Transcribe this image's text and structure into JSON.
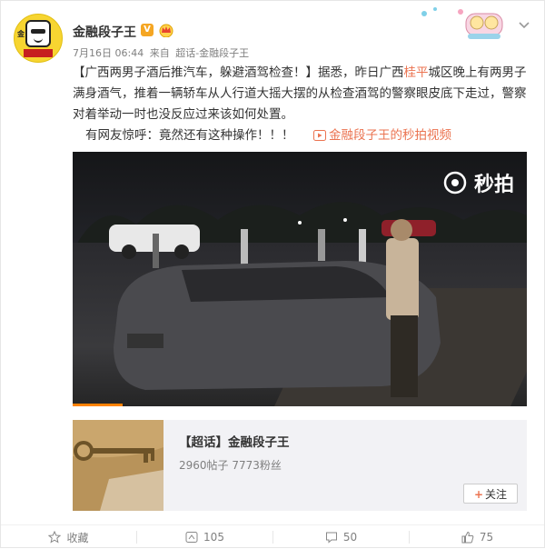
{
  "post": {
    "username": "金融段子王",
    "vip_badge": "V",
    "timestamp": "7月16日 06:44",
    "source_prefix": "来自",
    "source": "超话-金融段子王",
    "text_before": "【广西两男子酒后推汽车，躲避酒驾检查！】据悉，昨日广西",
    "text_highlight": "桂平",
    "text_after": "城区晚上有两男子满身酒气，推着一辆轿车从人行道大摇大摆的从检查酒驾的警察眼皮底下走过，警察对着举动一时也没反应过来该如何处置。",
    "line2": "有网友惊呼：竟然还有这种操作！！！",
    "video_link": "金融段子王的秒拍视频",
    "video_watermark": "秒拍",
    "video_progress": 0.11
  },
  "card": {
    "title": "【超话】金融段子王",
    "stats": "2960帖子 7773粉丝",
    "follow_label": "关注",
    "follow_plus": "+"
  },
  "actions": {
    "favorite": "收藏",
    "repost": "105",
    "comment": "50",
    "like": "75"
  },
  "colors": {
    "accent": "#eb7350",
    "meta": "#808080",
    "vip": "#f5a623"
  },
  "icons": [
    "avatar",
    "vip-badge-icon",
    "crown-icon",
    "dropdown-arrow-icon",
    "video-play-icon",
    "miaopai-logo-icon",
    "star-icon",
    "repost-icon",
    "comment-icon",
    "like-icon"
  ]
}
